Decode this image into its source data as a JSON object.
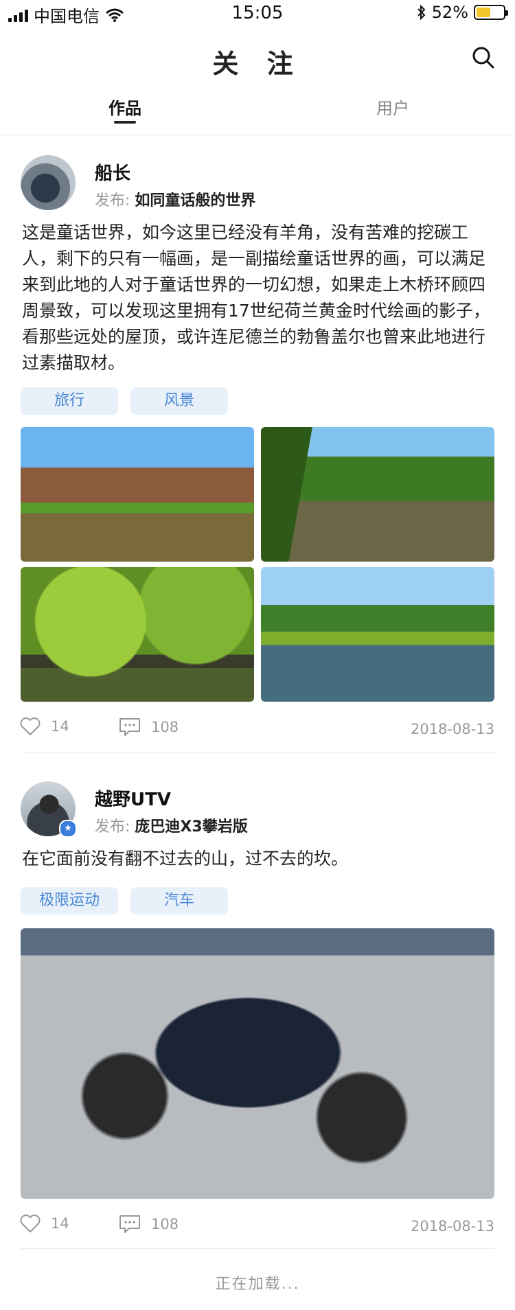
{
  "status_bar": {
    "carrier": "中国电信",
    "time": "15:05",
    "battery": "52%",
    "battery_level": 0.52
  },
  "nav": {
    "title": "关 注",
    "search_icon": "search-icon"
  },
  "tabs": [
    {
      "label": "作品",
      "active": true
    },
    {
      "label": "用户",
      "active": false
    }
  ],
  "posts": [
    {
      "username": "船长",
      "publish_prefix": "发布:",
      "publish_title": "如同童话般的世界",
      "text": "这是童话世界，如今这里已经没有羊角，没有苦难的挖碳工人，剩下的只有一幅画，是一副描绘童话世界的画，可以满足来到此地的人对于童话世界的一切幻想，如果走上木桥环顾四周景致，可以发现这里拥有17世纪荷兰黄金时代绘画的影子，看那些远处的屋顶，或许连尼德兰的勃鲁盖尔也曾来此地进行过素描取材。",
      "tags": [
        "旅行",
        "风景"
      ],
      "likes": "14",
      "comments": "108",
      "date": "2018-08-13"
    },
    {
      "username": "越野UTV",
      "publish_prefix": "发布:",
      "publish_title": "庞巴迪X3攀岩版",
      "text": "在它面前没有翻不过去的山，过不去的坎。",
      "tags": [
        "极限运动",
        "汽车"
      ],
      "likes": "14",
      "comments": "108",
      "date": "2018-08-13"
    }
  ],
  "footer": {
    "loading": "正在加载..."
  },
  "colors": {
    "accent": "#4a88d6",
    "tag_bg": "#e8f0fa",
    "battery": "#f3c62e"
  }
}
